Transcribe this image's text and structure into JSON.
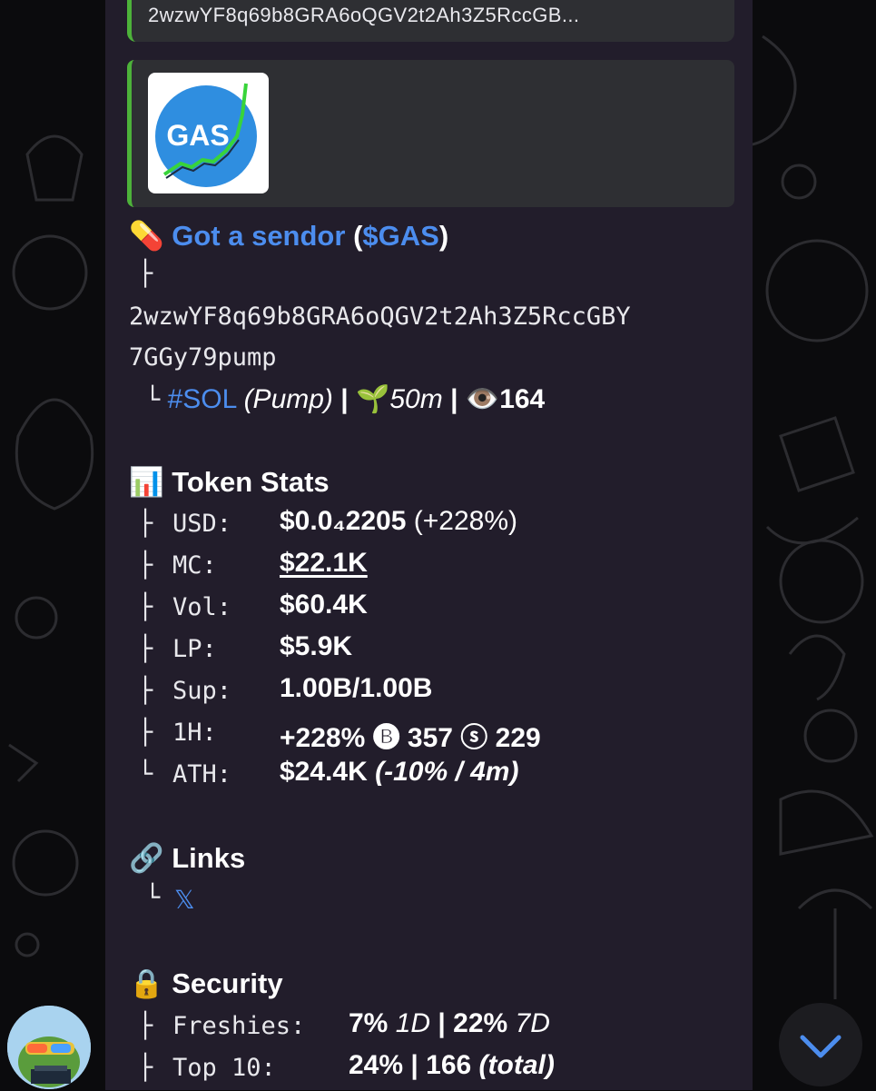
{
  "forward_header": {
    "address_truncated": "2wzwYF8q69b8GRA6oQGV2t2Ah3Z5RccGB..."
  },
  "link_preview": {
    "logo_text": "GAS"
  },
  "token": {
    "pill_emoji": "💊",
    "name": "Got a sendor",
    "ticker": "$GAS",
    "paren_open": "(",
    "paren_close": ")",
    "branch_top": "├",
    "address_line1": "2wzwYF8q69b8GRA6oQGV2t2Ah3Z5RccGBY",
    "address_line2": "7GGy79pump",
    "branch_end": "└",
    "chain_tag": "#SOL",
    "platform": "(Pump)",
    "separator": "|",
    "age_emoji": "🌱",
    "age": "50m",
    "views_emoji": "👁️",
    "views": "164"
  },
  "token_stats": {
    "emoji": "📊",
    "heading": "Token Stats",
    "rows": [
      {
        "branch": "├",
        "label": "USD:",
        "value": "$0.0₄2205",
        "extra": "(+228%)"
      },
      {
        "branch": "├",
        "label": "MC:",
        "value": "$22.1K"
      },
      {
        "branch": "├",
        "label": "Vol:",
        "value": "$60.4K"
      },
      {
        "branch": "├",
        "label": "LP:",
        "value": "$5.9K"
      },
      {
        "branch": "├",
        "label": "Sup:",
        "value": "1.00B/1.00B"
      },
      {
        "branch": "├",
        "label": "1H:",
        "value": "+228% 🅑 357 ⓢ 229"
      },
      {
        "branch": "└",
        "label": "ATH:",
        "value": "$24.4K",
        "extra": "(-10% / 4m)"
      }
    ]
  },
  "links": {
    "emoji": "🔗",
    "heading": "Links",
    "branch": "└",
    "x_label": "𝕏"
  },
  "security": {
    "emoji": "🔒",
    "heading": "Security",
    "rows": [
      {
        "branch": "├",
        "label": "Freshies:",
        "v1": "7%",
        "v1_period": "1D",
        "sep": "|",
        "v2": "22%",
        "v2_period": "7D"
      },
      {
        "branch": "├",
        "label": "Top 10:",
        "v1": "24%",
        "sep": "|",
        "v2": "166",
        "v2_period": "(total)"
      }
    ]
  },
  "colors": {
    "bubble": "#221d2b",
    "link": "#4c8dee",
    "accent_bar": "#4db23a",
    "scroll_arrow": "#4c8dee"
  }
}
